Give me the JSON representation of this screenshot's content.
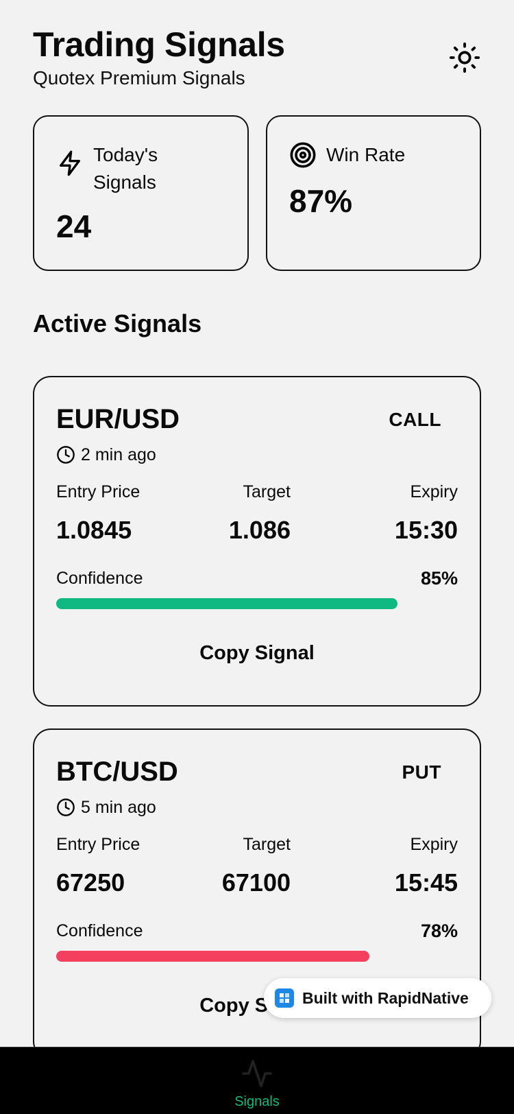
{
  "header": {
    "title": "Trading Signals",
    "subtitle": "Quotex Premium Signals",
    "theme_icon": "sun-icon"
  },
  "stats": {
    "today": {
      "label": "Today's Signals",
      "value": "24",
      "icon": "lightning-icon"
    },
    "win_rate": {
      "label": "Win Rate",
      "value": "87%",
      "icon": "target-icon"
    }
  },
  "section_title": "Active Signals",
  "signals": [
    {
      "pair": "EUR/USD",
      "direction": "CALL",
      "time": "2 min ago",
      "entry_label": "Entry Price",
      "entry_value": "1.0845",
      "target_label": "Target",
      "target_value": "1.086",
      "expiry_label": "Expiry",
      "expiry_value": "15:30",
      "confidence_label": "Confidence",
      "confidence_value": "85%",
      "confidence": 85,
      "bar_color": "#10b981",
      "copy_label": "Copy Signal"
    },
    {
      "pair": "BTC/USD",
      "direction": "PUT",
      "time": "5 min ago",
      "entry_label": "Entry Price",
      "entry_value": "67250",
      "target_label": "Target",
      "target_value": "67100",
      "expiry_label": "Expiry",
      "expiry_value": "15:45",
      "confidence_label": "Confidence",
      "confidence_value": "78%",
      "confidence": 78,
      "bar_color": "#f43f5e",
      "copy_label": "Copy Signal"
    }
  ],
  "badge": {
    "text": "Built with RapidNative",
    "icon": "rapidnative-logo-icon"
  },
  "nav": {
    "label": "Signals",
    "icon": "activity-icon",
    "active_color": "#10b981"
  }
}
